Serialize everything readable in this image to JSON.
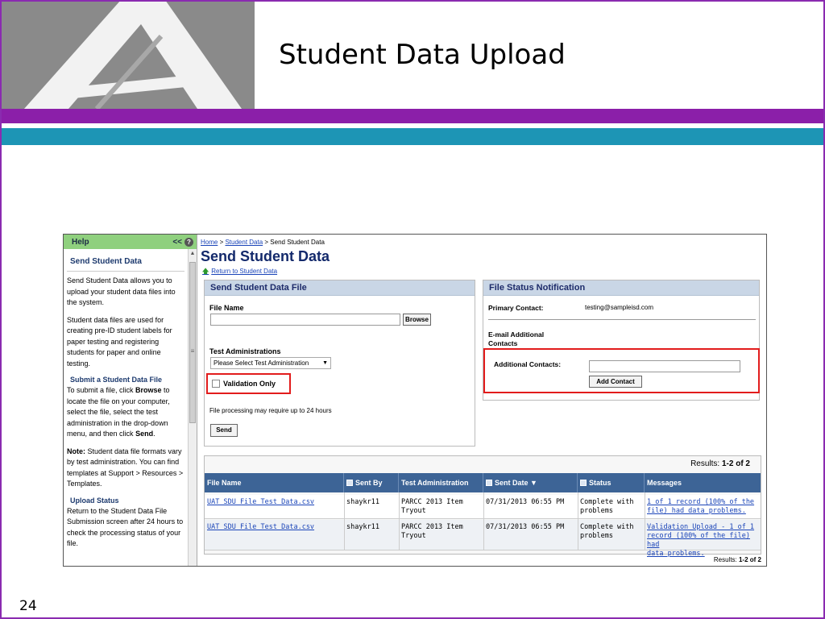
{
  "slide": {
    "title": "Student Data Upload",
    "number": "24"
  },
  "help": {
    "header": "Help",
    "collapse": "<<",
    "help_icon": "?",
    "section_title": "Send Student Data",
    "p1": "Send Student Data allows you to upload your student data files into the system.",
    "p2": "Student data files are used for creating pre-ID student labels for paper testing and registering students for paper and online testing.",
    "sub1": "Submit a Student Data File",
    "p3_a": "To submit a file, click ",
    "p3_b": "Browse",
    "p3_c": " to locate the file on your computer, select the file, select the test administration in the drop-down menu, and then click ",
    "p3_d": "Send",
    "p3_e": ".",
    "p4_a": "Note:",
    "p4_b": " Student data file formats vary by test administration. You can find templates at Support > Resources > Templates.",
    "sub2": "Upload Status",
    "p5": "Return to the Student Data File Submission screen after 24 hours to check the processing status of your file."
  },
  "breadcrumb": {
    "home": "Home",
    "sep1": " > ",
    "student_data": "Student Data",
    "sep2": " > ",
    "current": "Send Student Data"
  },
  "page": {
    "title": "Send Student Data",
    "return_link": "Return to Student Data"
  },
  "send_panel": {
    "title": "Send Student Data File",
    "file_name_label": "File Name",
    "browse": "Browse",
    "test_admin_label": "Test Administrations",
    "test_admin_selected": "Please Select Test Administration",
    "validation_only": "Validation Only",
    "note": "File processing may require up to 24 hours",
    "send": "Send"
  },
  "status_panel": {
    "title": "File Status Notification",
    "primary_label": "Primary Contact:",
    "primary_value": "testing@sampleisd.com",
    "email_label_1": "E-mail Additional",
    "email_label_2": "Contacts",
    "additional_label": "Additional Contacts:",
    "add_contact": "Add Contact"
  },
  "table": {
    "results_label": "Results: ",
    "results_value": "1-2 of 2",
    "columns": [
      "File Name",
      "Sent By",
      "Test Administration",
      "Sent Date",
      "Status",
      "Messages"
    ],
    "rows": [
      {
        "file": "UAT SDU File Test Data.csv",
        "sent_by": "shaykr11",
        "admin_1": "PARCC 2013 Item",
        "admin_2": "Tryout",
        "date": "07/31/2013 06:55 PM",
        "status_1": "Complete with",
        "status_2": "problems",
        "msg_1": "1 of 1 record (100% of the",
        "msg_2": "file) had data problems.",
        "msg_3": ""
      },
      {
        "file": "UAT SDU File Test Data.csv",
        "sent_by": "shaykr11",
        "admin_1": "PARCC 2013 Item",
        "admin_2": "Tryout",
        "date": "07/31/2013 06:55 PM",
        "status_1": "Complete with",
        "status_2": "problems",
        "msg_1": "Validation Upload - 1 of 1",
        "msg_2": "record (100% of the file) had",
        "msg_3": "data problems."
      }
    ],
    "results_bottom_label": "Results: ",
    "results_bottom_value": "1-2 of 2"
  }
}
